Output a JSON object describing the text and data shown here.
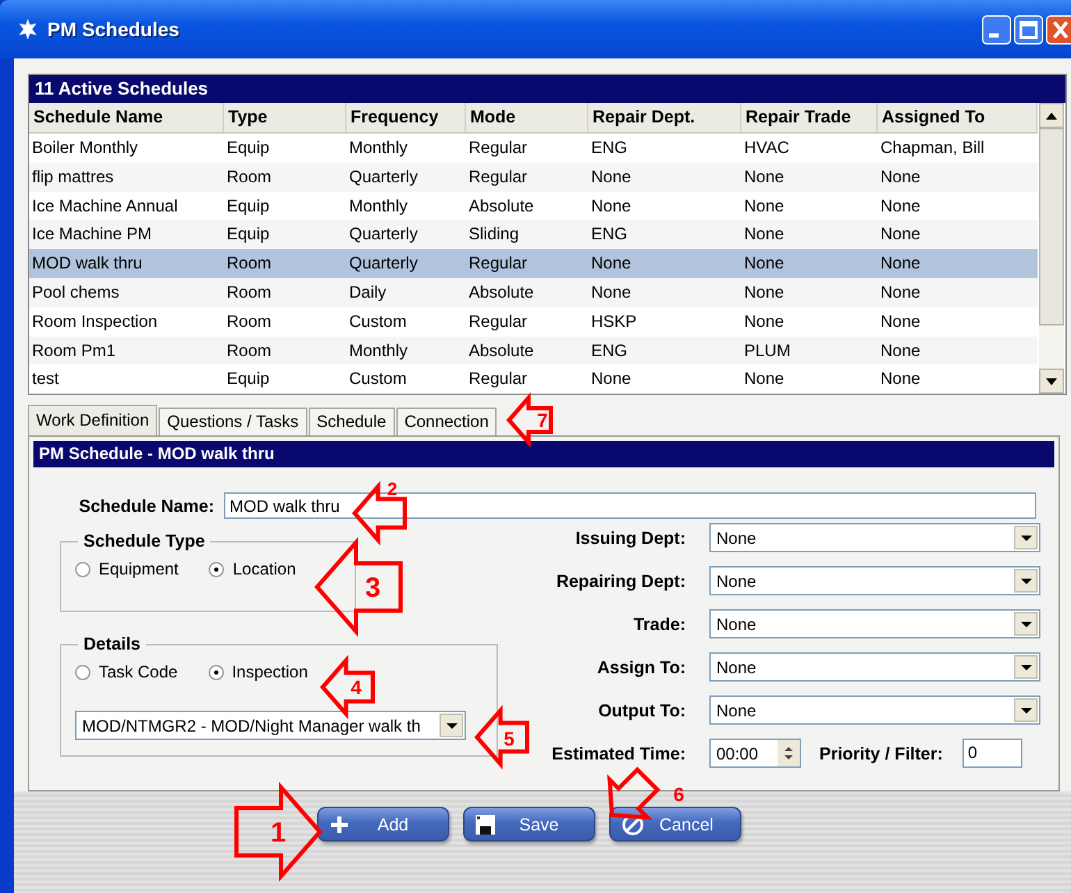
{
  "window": {
    "title": "PM Schedules"
  },
  "schedules": {
    "title": "11 Active Schedules",
    "columns": [
      "Schedule Name",
      "Type",
      "Frequency",
      "Mode",
      "Repair Dept.",
      "Repair Trade",
      "Assigned To"
    ],
    "rows": [
      {
        "cells": [
          "Boiler Monthly",
          "Equip",
          "Monthly",
          "Regular",
          "ENG",
          "HVAC",
          "Chapman, Bill"
        ],
        "selected": false
      },
      {
        "cells": [
          "flip mattres",
          "Room",
          "Quarterly",
          "Regular",
          "None",
          "None",
          "None"
        ],
        "selected": false
      },
      {
        "cells": [
          "Ice Machine Annual",
          "Equip",
          "Monthly",
          "Absolute",
          "None",
          "None",
          "None"
        ],
        "selected": false
      },
      {
        "cells": [
          "Ice Machine PM",
          "Equip",
          "Quarterly",
          "Sliding",
          "ENG",
          "None",
          "None"
        ],
        "selected": false
      },
      {
        "cells": [
          "MOD walk thru",
          "Room",
          "Quarterly",
          "Regular",
          "None",
          "None",
          "None"
        ],
        "selected": true
      },
      {
        "cells": [
          "Pool chems",
          "Room",
          "Daily",
          "Absolute",
          "None",
          "None",
          "None"
        ],
        "selected": false
      },
      {
        "cells": [
          "Room Inspection",
          "Room",
          "Custom",
          "Regular",
          "HSKP",
          "None",
          "None"
        ],
        "selected": false
      },
      {
        "cells": [
          "Room Pm1",
          "Room",
          "Monthly",
          "Absolute",
          "ENG",
          "PLUM",
          "None"
        ],
        "selected": false
      },
      {
        "cells": [
          "test",
          "Equip",
          "Custom",
          "Regular",
          "None",
          "None",
          "None"
        ],
        "selected": false
      }
    ]
  },
  "tabs": [
    {
      "label": "Work Definition",
      "selected": true
    },
    {
      "label": "Questions / Tasks",
      "selected": false
    },
    {
      "label": "Schedule",
      "selected": false
    },
    {
      "label": "Connection",
      "selected": false
    }
  ],
  "form": {
    "title": "PM Schedule - MOD walk thru",
    "name_label": "Schedule Name:",
    "name_value": "MOD walk thru",
    "schedule_type": {
      "title": "Schedule Type",
      "options": [
        {
          "label": "Equipment",
          "selected": false
        },
        {
          "label": "Location",
          "selected": true
        }
      ]
    },
    "details": {
      "title": "Details",
      "options": [
        {
          "label": "Task Code",
          "selected": false
        },
        {
          "label": "Inspection",
          "selected": true
        }
      ],
      "dropdown_value": "MOD/NTMGR2 - MOD/Night Manager walk th"
    },
    "fields": [
      {
        "label": "Issuing Dept:",
        "value": "None"
      },
      {
        "label": "Repairing Dept:",
        "value": "None"
      },
      {
        "label": "Trade:",
        "value": "None"
      },
      {
        "label": "Assign To:",
        "value": "None"
      },
      {
        "label": "Output To:",
        "value": "None"
      }
    ],
    "estimated_time": {
      "label": "Estimated Time:",
      "value": "00:00"
    },
    "priority": {
      "label": "Priority / Filter:",
      "value": "0"
    }
  },
  "buttons": [
    {
      "label": "Add",
      "kind": "add"
    },
    {
      "label": "Save",
      "kind": "save"
    },
    {
      "label": "Cancel",
      "kind": "cancel"
    }
  ],
  "callouts": [
    {
      "number": "1",
      "kind": "arrow-right"
    },
    {
      "number": "2",
      "kind": "arrow-left"
    },
    {
      "number": "3",
      "kind": "arrow-left"
    },
    {
      "number": "4",
      "kind": "arrow-left"
    },
    {
      "number": "5",
      "kind": "arrow-left"
    },
    {
      "number": "6",
      "kind": "arrow-down-left"
    },
    {
      "number": "7",
      "kind": "arrow-left"
    }
  ]
}
